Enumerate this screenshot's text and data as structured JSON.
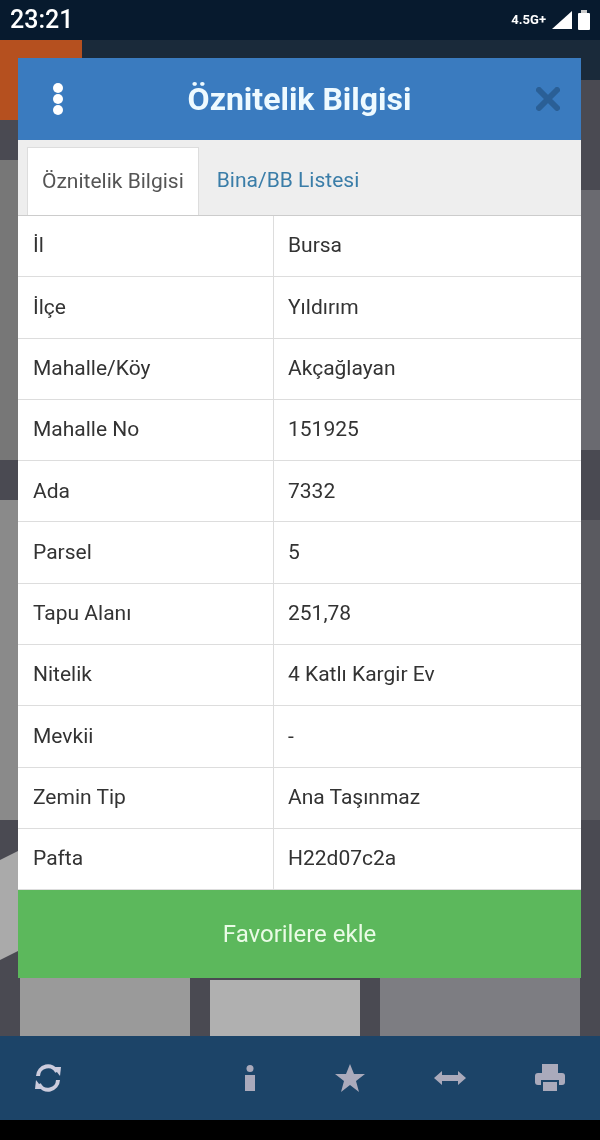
{
  "status_bar": {
    "time": "23:21",
    "network": "4.5G+"
  },
  "dialog": {
    "title": "Öznitelik Bilgisi",
    "tabs": [
      {
        "label": "Öznitelik Bilgisi",
        "selected": true
      },
      {
        "label": "Bina/BB Listesi",
        "selected": false
      }
    ],
    "rows": [
      {
        "label": "İl",
        "value": "Bursa"
      },
      {
        "label": "İlçe",
        "value": "Yıldırım"
      },
      {
        "label": "Mahalle/Köy",
        "value": "Akçağlayan"
      },
      {
        "label": "Mahalle No",
        "value": "151925"
      },
      {
        "label": "Ada",
        "value": "7332"
      },
      {
        "label": "Parsel",
        "value": "5"
      },
      {
        "label": "Tapu Alanı",
        "value": "251,78"
      },
      {
        "label": "Nitelik",
        "value": "4 Katlı Kargir Ev"
      },
      {
        "label": "Mevkii",
        "value": "-"
      },
      {
        "label": "Zemin Tip",
        "value": "Ana Taşınmaz"
      },
      {
        "label": "Pafta",
        "value": "H22d07c2a"
      }
    ],
    "button": "Favorilere ekle"
  }
}
